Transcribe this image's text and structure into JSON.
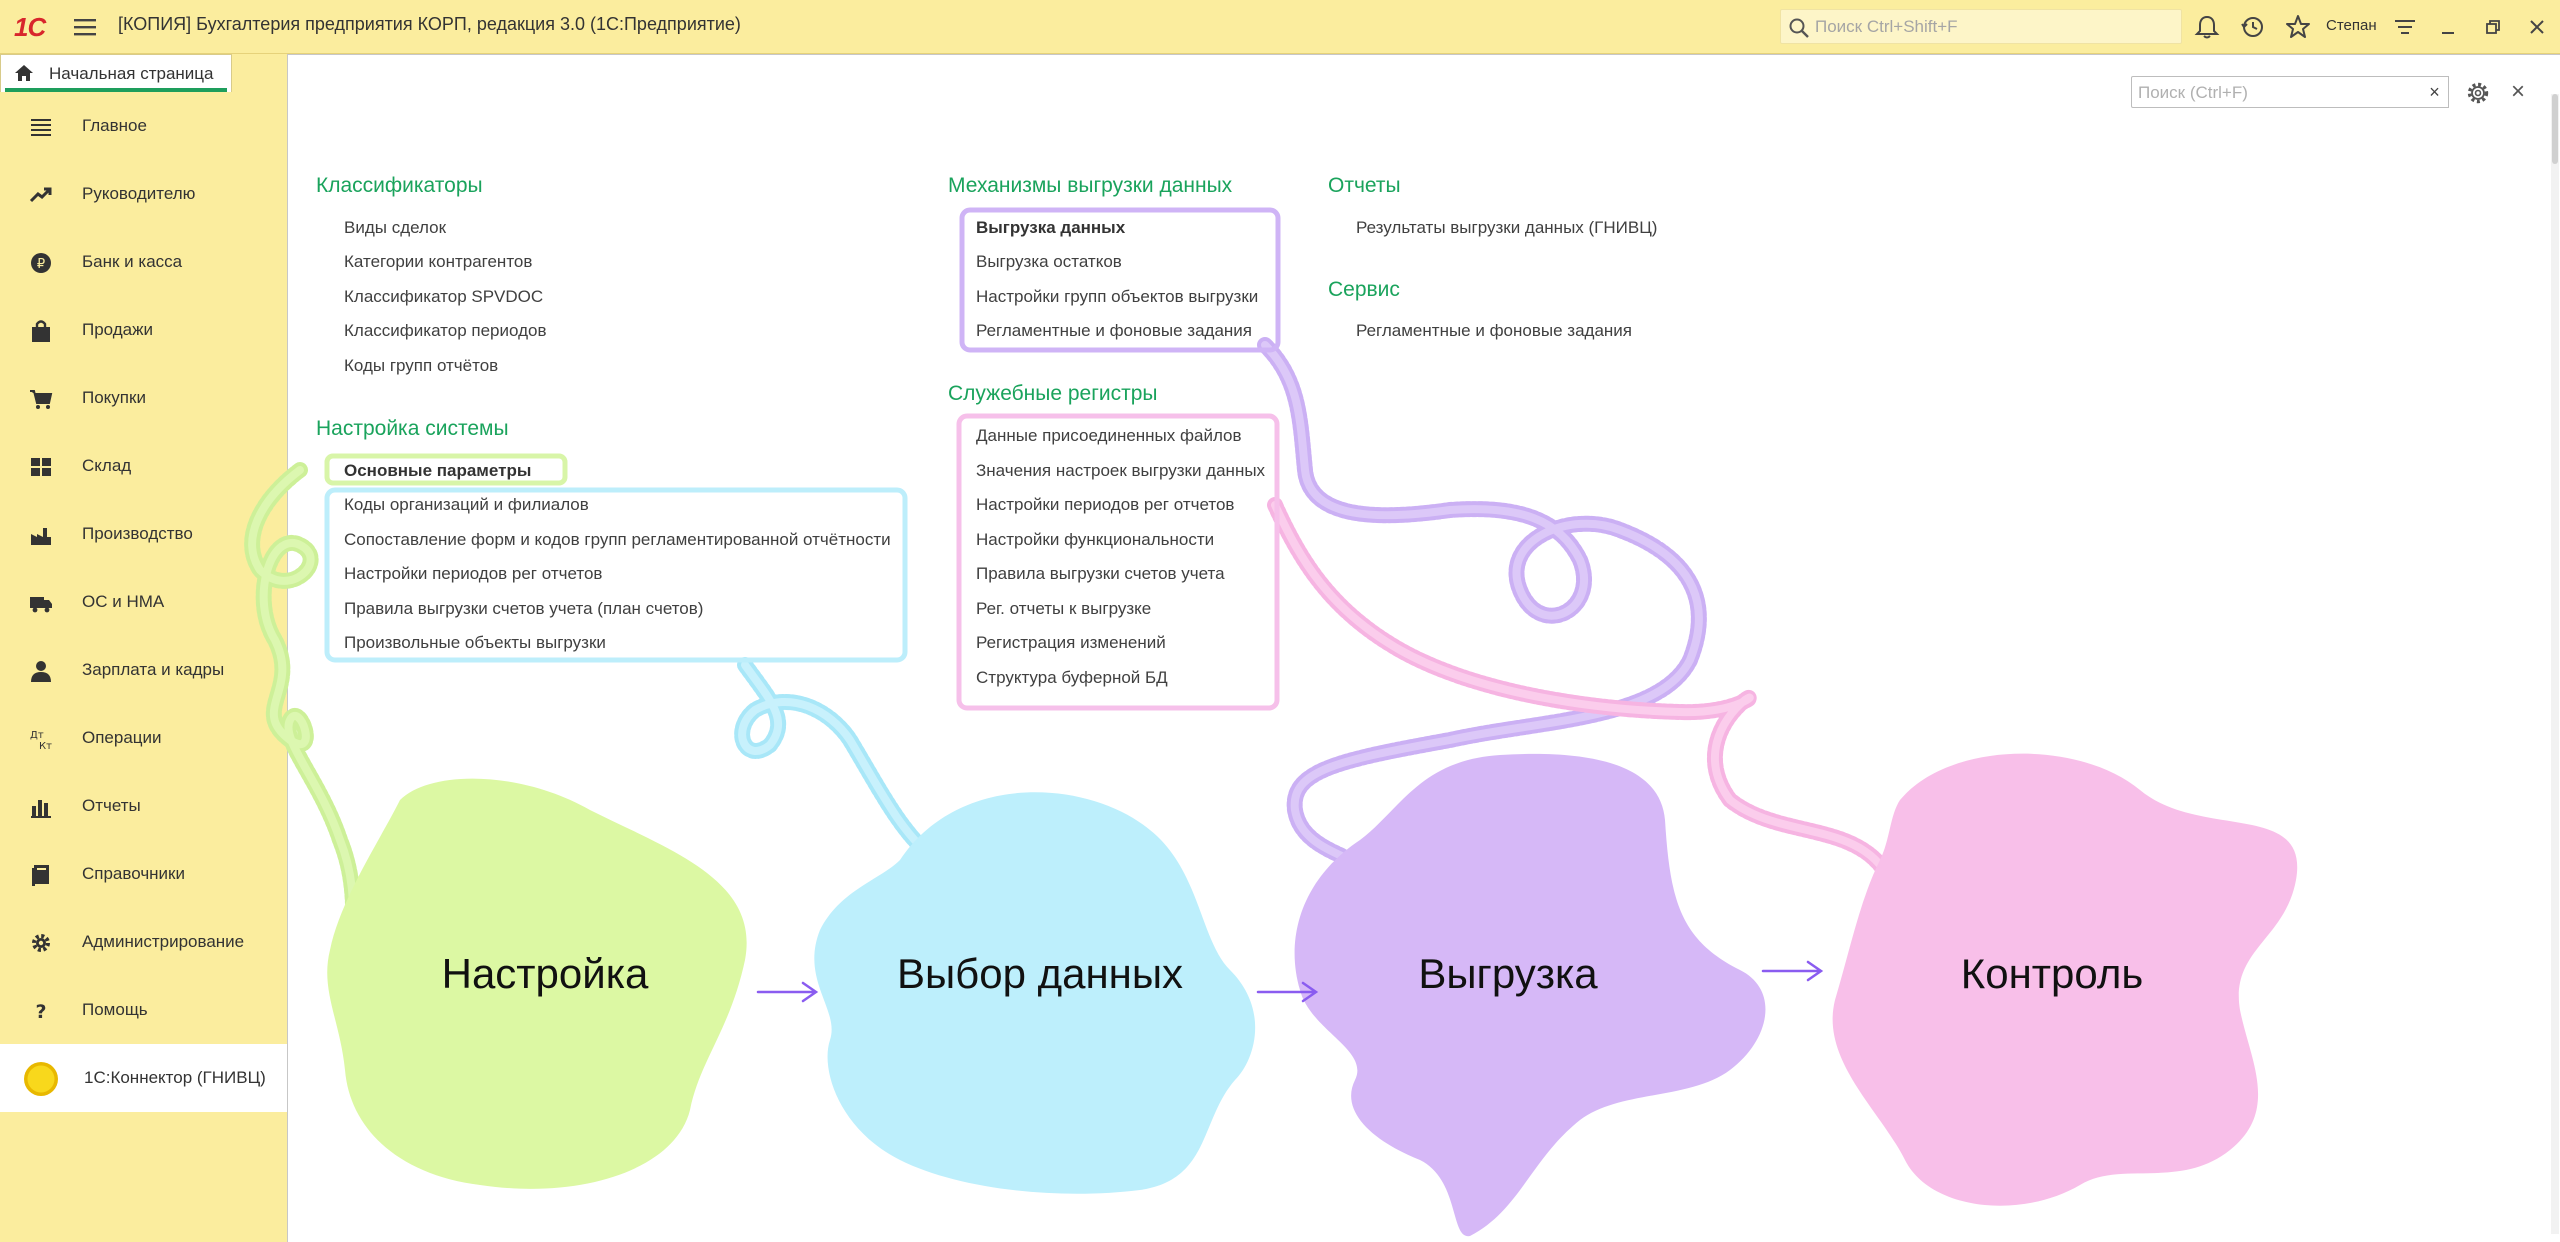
{
  "titlebar": {
    "logo": "1С",
    "title": "[КОПИЯ] Бухгалтерия предприятия КОРП, редакция 3.0  (1С:Предприятие)",
    "search_placeholder": "Поиск Ctrl+Shift+F",
    "user": "Степан"
  },
  "tabs": {
    "home": "Начальная страница"
  },
  "sidebar": {
    "items": [
      {
        "label": "Главное",
        "icon": "menu-lines-icon"
      },
      {
        "label": "Руководителю",
        "icon": "trend-up-icon"
      },
      {
        "label": "Банк и касса",
        "icon": "ruble-coin-icon"
      },
      {
        "label": "Продажи",
        "icon": "shopping-bag-icon"
      },
      {
        "label": "Покупки",
        "icon": "shopping-cart-icon"
      },
      {
        "label": "Склад",
        "icon": "warehouse-grid-icon"
      },
      {
        "label": "Производство",
        "icon": "factory-icon"
      },
      {
        "label": "ОС и НМА",
        "icon": "truck-icon"
      },
      {
        "label": "Зарплата и кадры",
        "icon": "person-icon"
      },
      {
        "label": "Операции",
        "icon": "dt-kt-icon"
      },
      {
        "label": "Отчеты",
        "icon": "bar-chart-icon"
      },
      {
        "label": "Справочники",
        "icon": "book-icon"
      },
      {
        "label": "Администрирование",
        "icon": "gear-icon"
      },
      {
        "label": "Помощь",
        "icon": "question-icon"
      },
      {
        "label": "1С:Коннектор (ГНИВЦ)",
        "icon": "yellow-circle-icon"
      }
    ]
  },
  "content": {
    "search_placeholder": "Поиск (Ctrl+F)",
    "clear": "×",
    "close": "×",
    "classifiers": {
      "title": "Классификаторы",
      "items": [
        "Виды сделок",
        "Категории контрагентов",
        "Классификатор SPVDOC",
        "Классификатор периодов",
        "Коды групп отчётов"
      ]
    },
    "system_settings": {
      "title": "Настройка системы",
      "items": [
        "Основные параметры",
        "Коды организаций и филиалов",
        "Сопоставление форм и кодов групп регламентированной отчётности",
        "Настройки периодов рег отчетов",
        "Правила выгрузки счетов учета (план счетов)",
        "Произвольные объекты выгрузки"
      ]
    },
    "export_mechanisms": {
      "title": "Механизмы выгрузки данных",
      "items": [
        "Выгрузка данных",
        "Выгрузка остатков",
        "Настройки групп объектов выгрузки",
        "Регламентные и фоновые задания"
      ]
    },
    "service_registers": {
      "title": "Служебные регистры",
      "items": [
        "Данные присоединенных файлов",
        "Значения настроек выгрузки данных",
        "Настройки периодов рег отчетов",
        "Настройки функциональности",
        "Правила выгрузки счетов учета",
        "Рег. отчеты к выгрузке",
        "Регистрация изменений",
        "Структура буферной БД"
      ]
    },
    "reports": {
      "title": "Отчеты",
      "items": [
        "Результаты выгрузки данных (ГНИВЦ)"
      ]
    },
    "service": {
      "title": "Сервис",
      "items": [
        "Регламентные и фоновые задания"
      ]
    }
  },
  "stages": [
    "Настройка",
    "Выбор данных",
    "Выгрузка",
    "Контроль"
  ],
  "colors": {
    "titlebar": "#fbed9e",
    "section_title": "#1aa35c",
    "stage_green": "#dcf7a0",
    "stage_blue": "#bdeefb",
    "stage_purple": "#d8b8f8",
    "stage_pink": "#f8c0ea",
    "arrow": "#8a5cf0"
  }
}
